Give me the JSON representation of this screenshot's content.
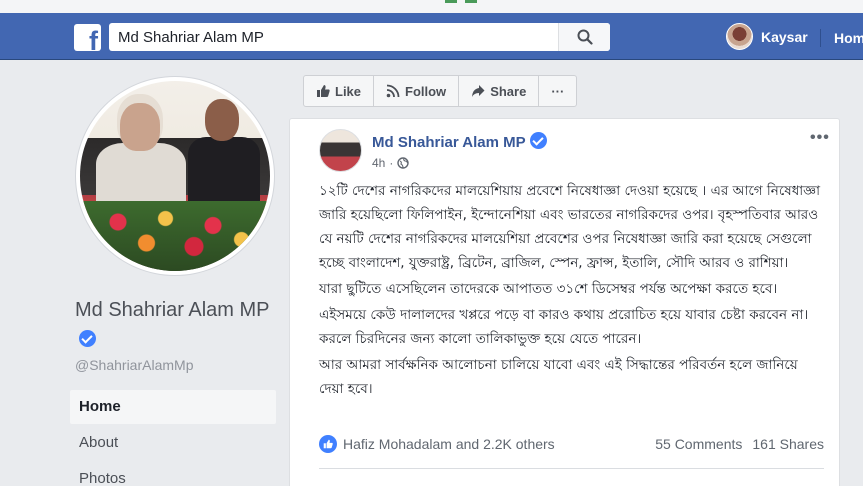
{
  "header": {
    "search_value": "Md Shahriar Alam MP",
    "search_icon": "search-icon",
    "user_name": "Kaysar",
    "home_label": "Home"
  },
  "page": {
    "name": "Md Shahriar Alam MP",
    "handle": "@ShahriarAlamMp",
    "nav": [
      "Home",
      "About",
      "Photos"
    ]
  },
  "toolbar": {
    "like_label": "Like",
    "follow_label": "Follow",
    "share_label": "Share",
    "more_label": "···"
  },
  "post": {
    "author": "Md Shahriar Alam MP",
    "time": "4h",
    "paragraphs": [
      "১২টি দেশের নাগরিকদের মালয়েশিয়ায় প্রবেশে নিষেধাজ্ঞা দেওয়া হয়েছে । এর আগে নিষেধাজ্ঞা জারি হয়েছিলো ফিলিপাইন, ইন্দোনেশিয়া এবং ভারতের নাগরিকদের ওপর। বৃহস্পতিবার আরও যে নয়টি দেশের নাগরিকদের মালয়েশিয়া প্রবেশের ওপর নিষেধাজ্ঞা জারি করা হয়েছে সেগুলো হচ্ছে বাংলাদেশ, যুক্তরাষ্ট্র, ব্রিটেন, ব্রাজিল, স্পেন, ফ্রান্স, ইতালি, সৌদি আরব ও রাশিয়া।",
      "যারা ছুটিতে এসেছিলেন তাদেরকে আপাতত ৩১শে ডিসেম্বর পর্যন্ত অপেক্ষা করতে হবে।",
      "এইসময়ে কেউ দালালদের খপ্পরে পড়ে বা কারও কথায় প্ররোচিত হয়ে যাবার চেষ্টা করবেন না। করলে চিরদিনের জন্য কালো তালিকাভুক্ত হয়ে যেতে পারেন।",
      "আর আমরা সার্বক্ষনিক আলোচনা চালিয়ে যাবো এবং এই সিদ্ধান্তের পরিবর্তন হলে জানিয়ে দেয়া হবে।"
    ],
    "likes_text": "Hafiz Mohadalam and 2.2K others",
    "comments": "55 Comments",
    "shares": "161 Shares"
  },
  "colors": {
    "brand": "#4267b2",
    "link": "#385898",
    "verified": "#4080ff"
  }
}
